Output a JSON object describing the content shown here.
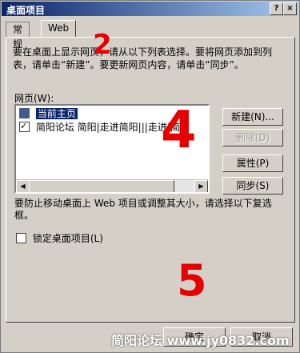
{
  "window": {
    "title": "桌面项目",
    "help_btn": "?",
    "close_btn": "×"
  },
  "tabs": [
    {
      "label": "常规"
    },
    {
      "label": "Web"
    }
  ],
  "description": "要在桌面上显示网页，请从以下列表选择。要将网页添加到列表，请单击“新建”。要更新网页内容，请单击“同步”。",
  "list": {
    "label": "网页(W):",
    "items": [
      {
        "label": "当前主页",
        "checked": false
      },
      {
        "label": "简阳论坛 简阳|走进简阳|||走进|简阳",
        "checked": true
      }
    ]
  },
  "buttons": {
    "new": "新建(N)...",
    "delete": "删除(D)",
    "properties": "属性(P)",
    "sync": "同步(S)"
  },
  "lock_text": "要防止移动桌面上 Web 项目或调整其大小，请选择以下复选框。",
  "lock_checkbox": {
    "label": "锁定桌面项目(L)",
    "checked": false
  },
  "bottom": {
    "ok": "确定",
    "cancel": "取消"
  },
  "watermark": "简阳论坛 www.jy0832.com",
  "annotations": {
    "a2": "2",
    "a4": "4",
    "a5": "5"
  }
}
